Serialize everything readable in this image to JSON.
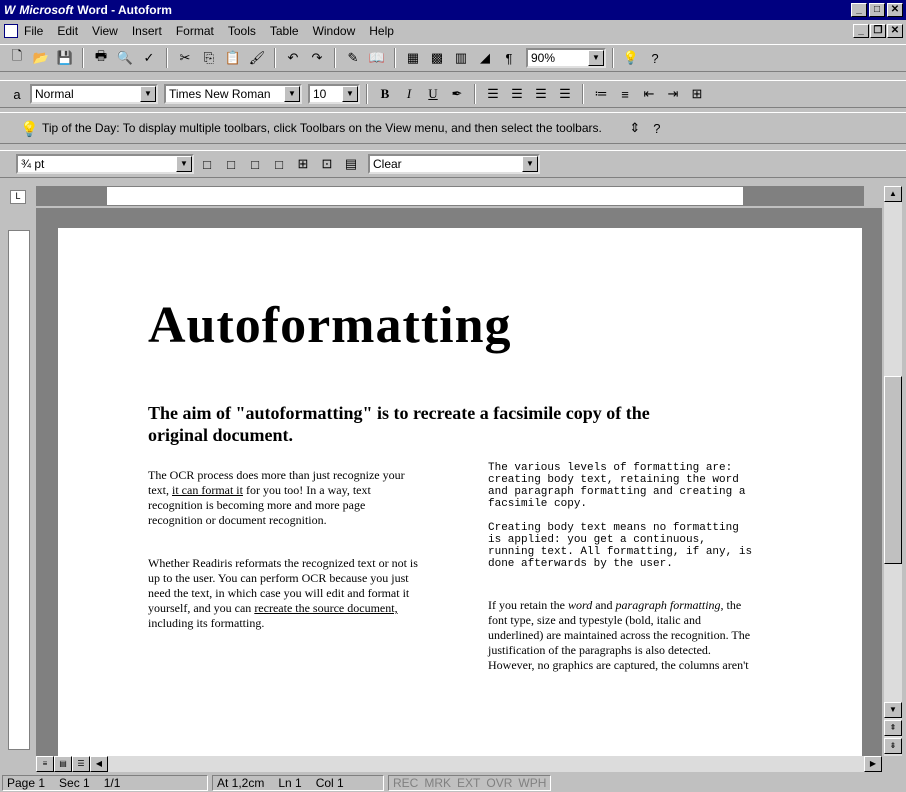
{
  "window": {
    "brand": "Microsoft",
    "title": "Word - Autoform"
  },
  "menu": [
    "File",
    "Edit",
    "View",
    "Insert",
    "Format",
    "Tools",
    "Table",
    "Window",
    "Help"
  ],
  "standard_toolbar": {
    "zoom": "90%"
  },
  "formatting_toolbar": {
    "style": "Normal",
    "font": "Times New Roman",
    "size": "10"
  },
  "tip": {
    "text": "Tip of the Day: To display multiple toolbars, click Toolbars on the View menu, and then select the toolbars."
  },
  "borders_toolbar": {
    "line_width": "¾ pt",
    "shading": "Clear"
  },
  "document": {
    "title": "Autoformatting",
    "subtitle": "The aim of \"autoformatting\" is to recreate a facsimile copy of the original document.",
    "col1": {
      "p1_a": "The OCR process does more than just recognize your text, ",
      "p1_link": "it can format it",
      "p1_b": " for you too! In a way, text recognition is becoming more and more page recognition or document recognition.",
      "p2_a": "Whether Readiris reformats the recognized text or not is up to the user. You can perform OCR because you just need the text, in which case you will edit and format it yourself, and you can ",
      "p2_link": "recreate the source document,",
      "p2_b": " including its formatting."
    },
    "col2": {
      "p1": "The various levels of formatting are: creating body text, retaining the word and paragraph formatting and creating a facsimile copy.",
      "p2": "Creating body text means no formatting is applied: you get a continuous, running text. All formatting, if any, is done afterwards by the user.",
      "p3_a": "If you retain the ",
      "p3_i1": "word",
      "p3_mid": " and ",
      "p3_i2": "paragraph formatting,",
      "p3_b": " the font type, size and typestyle (bold, italic and underlined) are maintained across the recognition. The justification of the paragraphs is also detected. However, no graphics are captured, the columns aren't"
    }
  },
  "status": {
    "page": "Page 1",
    "sec": "Sec 1",
    "pages": "1/1",
    "at": "At 1,2cm",
    "ln": "Ln 1",
    "col": "Col 1",
    "rec": "REC",
    "mrk": "MRK",
    "ext": "EXT",
    "ovr": "OVR",
    "wph": "WPH"
  }
}
